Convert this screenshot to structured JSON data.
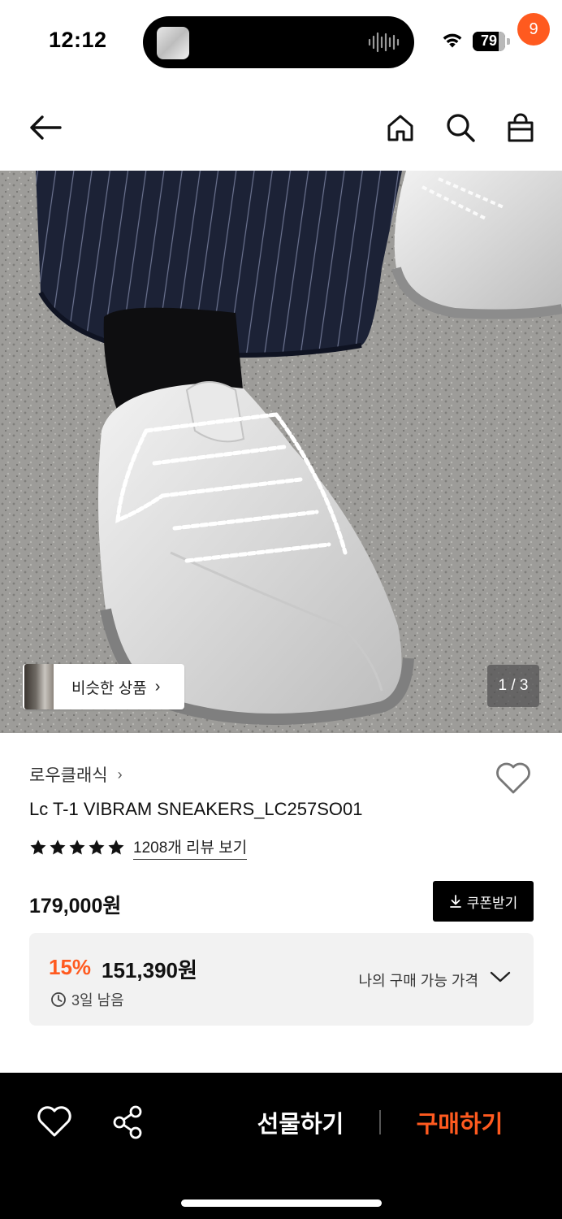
{
  "status_bar": {
    "time": "12:12",
    "battery": "79",
    "battery_level": 0.79
  },
  "header": {
    "cart_count": "9",
    "icons": [
      "arrow-left-icon",
      "home-icon",
      "search-icon",
      "shopping-bag-icon"
    ]
  },
  "gallery": {
    "similar_label": "비슷한 상품",
    "similar_chevron": "›",
    "page_indicator": "1 / 3"
  },
  "product": {
    "brand": "로우클래식",
    "brand_chevron": "›",
    "name": "Lc T-1 VIBRAM SNEAKERS_LC257SO01",
    "rating_stars": 5,
    "review_link": "1208개 리뷰 보기",
    "original_price": "179,000원",
    "coupon_label": "쿠폰받기",
    "discount_rate": "15%",
    "sale_price": "151,390원",
    "remaining": "3일 남음",
    "my_price_label": "나의 구매 가능 가격"
  },
  "bottom_bar": {
    "gift_label": "선물하기",
    "buy_label": "구매하기"
  },
  "colors": {
    "accent": "#ff5a1f",
    "dark": "#000000",
    "price_box": "#f2f2f2"
  }
}
